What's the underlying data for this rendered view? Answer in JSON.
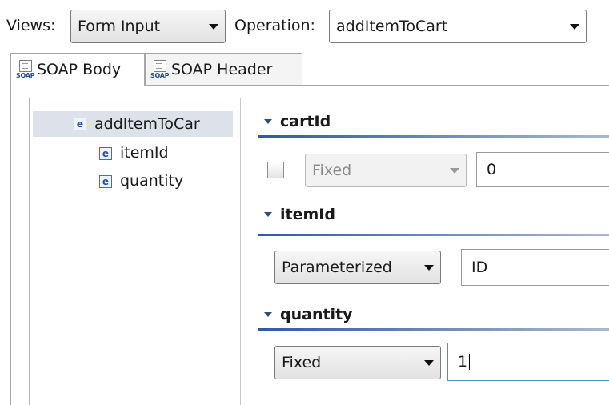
{
  "toolbar": {
    "views_label": "Views:",
    "views_value": "Form Input",
    "operation_label": "Operation:",
    "operation_value": "addItemToCart"
  },
  "tabs": [
    {
      "label": "SOAP Body",
      "icon": "soap-body-icon",
      "icon_text": "SOAP",
      "active": true
    },
    {
      "label": "SOAP Header",
      "icon": "soap-header-icon",
      "icon_text": "SOAP",
      "active": false
    }
  ],
  "tree": {
    "element_icon_text": "e",
    "root": "addItemToCar",
    "children": [
      "itemId",
      "quantity"
    ]
  },
  "form": {
    "cartId": {
      "title": "cartId",
      "mode": "Fixed",
      "value": "0",
      "checked": false,
      "enabled": false
    },
    "itemId": {
      "title": "itemId",
      "mode": "Parameterized",
      "value": "ID"
    },
    "quantity": {
      "title": "quantity",
      "mode": "Fixed",
      "value": "1"
    }
  },
  "colors": {
    "section_line": "#2f5aa0",
    "tree_selection": "#dde2ea",
    "element_icon": "#3f6fb5"
  }
}
